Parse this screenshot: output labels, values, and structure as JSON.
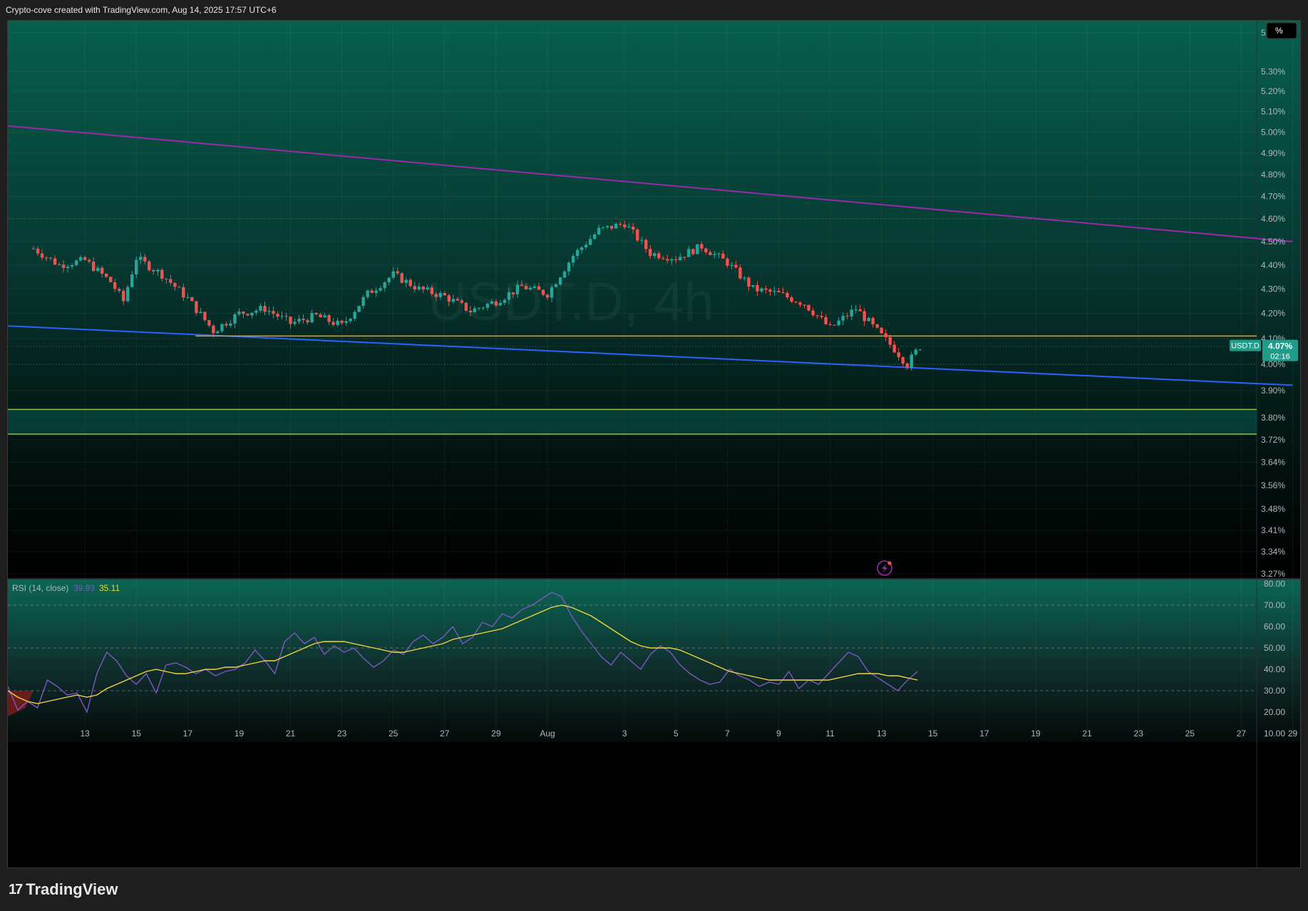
{
  "header": {
    "caption": "Crypto-cove created with TradingView.com, Aug 14, 2025 17:57 UTC+6"
  },
  "brand": {
    "mark": "17",
    "name": "TradingView"
  },
  "main_pane": {
    "watermark": "USDT.D, 4h",
    "scale_button": "%",
    "price_tag": {
      "symbol": "USDT.D",
      "value": "4.07%",
      "countdown": "02:16"
    },
    "y_ticks": [
      "5.50%",
      "5.30%",
      "5.20%",
      "5.10%",
      "5.00%",
      "4.90%",
      "4.80%",
      "4.70%",
      "4.60%",
      "4.50%",
      "4.40%",
      "4.30%",
      "4.20%",
      "4.10%",
      "4.00%",
      "3.90%",
      "3.80%",
      "3.72%",
      "3.64%",
      "3.56%",
      "3.48%",
      "3.41%",
      "3.34%",
      "3.27%"
    ]
  },
  "rsi_pane": {
    "label": "RSI (14, close)",
    "rsi_value": "39.93",
    "ma_value": "35.11",
    "y_ticks": [
      "80.00",
      "70.00",
      "60.00",
      "50.00",
      "40.00",
      "30.00",
      "20.00",
      "10.00"
    ]
  },
  "time_axis": {
    "labels": [
      "13",
      "15",
      "17",
      "19",
      "21",
      "23",
      "25",
      "27",
      "29",
      "Aug",
      "3",
      "5",
      "7",
      "9",
      "11",
      "13",
      "15",
      "17",
      "19",
      "21",
      "23",
      "25",
      "27",
      "29"
    ]
  },
  "colors": {
    "bull": "#26a69a",
    "bear": "#ef5350",
    "upper_trendline": "#9c27b0",
    "lower_trendline": "#2962ff",
    "horizontal_level": "#ff9800",
    "support_zone": "#8bc34a",
    "rsi_line": "#7e57c2",
    "rsi_ma": "#f5d33a"
  },
  "chart_data": [
    {
      "type": "candlestick",
      "symbol": "USDT.D",
      "timeframe": "4h",
      "y_unit": "%",
      "ylim": [
        3.27,
        5.55
      ],
      "y_scale": "log",
      "x_range": [
        "Jul 11",
        "Aug 30"
      ],
      "approx_closes": [
        {
          "date": "Jul 11",
          "close": 4.47
        },
        {
          "date": "Jul 12",
          "close": 4.4
        },
        {
          "date": "Jul 13",
          "close": 4.42
        },
        {
          "date": "Jul 14",
          "close": 4.33
        },
        {
          "date": "Jul 14.5",
          "close": 4.25
        },
        {
          "date": "Jul 15",
          "close": 4.43
        },
        {
          "date": "Jul 16",
          "close": 4.36
        },
        {
          "date": "Jul 17",
          "close": 4.26
        },
        {
          "date": "Jul 18",
          "close": 4.13
        },
        {
          "date": "Jul 19",
          "close": 4.2
        },
        {
          "date": "Jul 20",
          "close": 4.22
        },
        {
          "date": "Jul 21",
          "close": 4.16
        },
        {
          "date": "Jul 22",
          "close": 4.19
        },
        {
          "date": "Jul 23",
          "close": 4.15
        },
        {
          "date": "Jul 24",
          "close": 4.28
        },
        {
          "date": "Jul 25",
          "close": 4.36
        },
        {
          "date": "Jul 26",
          "close": 4.3
        },
        {
          "date": "Jul 27",
          "close": 4.27
        },
        {
          "date": "Jul 28",
          "close": 4.21
        },
        {
          "date": "Jul 29",
          "close": 4.25
        },
        {
          "date": "Jul 30",
          "close": 4.31
        },
        {
          "date": "Jul 31",
          "close": 4.28
        },
        {
          "date": "Aug 1",
          "close": 4.44
        },
        {
          "date": "Aug 2",
          "close": 4.55
        },
        {
          "date": "Aug 3",
          "close": 4.58
        },
        {
          "date": "Aug 4",
          "close": 4.45
        },
        {
          "date": "Aug 5",
          "close": 4.43
        },
        {
          "date": "Aug 6",
          "close": 4.48
        },
        {
          "date": "Aug 7",
          "close": 4.41
        },
        {
          "date": "Aug 8",
          "close": 4.3
        },
        {
          "date": "Aug 9",
          "close": 4.28
        },
        {
          "date": "Aug 10",
          "close": 4.24
        },
        {
          "date": "Aug 11",
          "close": 4.14
        },
        {
          "date": "Aug 12",
          "close": 4.22
        },
        {
          "date": "Aug 13",
          "close": 4.11
        },
        {
          "date": "Aug 13.5",
          "close": 4.06
        },
        {
          "date": "Aug 14",
          "close": 4.0
        },
        {
          "date": "Aug 14.5",
          "close": 4.07
        }
      ],
      "current_value": 4.07,
      "annotations": [
        {
          "kind": "trendline",
          "name": "upper",
          "color": "purple",
          "from": {
            "date": "Jul 10",
            "value": 5.03
          },
          "to": {
            "date": "Aug 29",
            "value": 4.5
          }
        },
        {
          "kind": "trendline",
          "name": "lower",
          "color": "blue",
          "from": {
            "date": "Jul 10",
            "value": 4.15
          },
          "to": {
            "date": "Aug 29",
            "value": 3.92
          }
        },
        {
          "kind": "horizontal",
          "color": "orange",
          "value": 4.11
        },
        {
          "kind": "zone",
          "color": "green",
          "from": 3.74,
          "to": 3.83
        }
      ]
    },
    {
      "type": "line",
      "name": "RSI (14, close)",
      "ylim": [
        10,
        80
      ],
      "bands": [
        30,
        50,
        70
      ],
      "series": [
        {
          "name": "RSI",
          "values": [
            32,
            21,
            25,
            22,
            35,
            32,
            28,
            29,
            20,
            38,
            48,
            44,
            37,
            33,
            38,
            29,
            42,
            43,
            41,
            38,
            40,
            37,
            39,
            40,
            43,
            49,
            44,
            38,
            53,
            57,
            52,
            55,
            47,
            51,
            48,
            50,
            45,
            41,
            44,
            49,
            47,
            53,
            56,
            52,
            55,
            60,
            52,
            55,
            62,
            60,
            66,
            64,
            68,
            70,
            73,
            76,
            74,
            65,
            58,
            52,
            46,
            42,
            48,
            44,
            40,
            47,
            51,
            48,
            42,
            38,
            35,
            33,
            34,
            40,
            37,
            35,
            32,
            34,
            33,
            39,
            31,
            35,
            33,
            38,
            43,
            48,
            46,
            39,
            36,
            33,
            30,
            35,
            39
          ],
          "last": 39.93
        },
        {
          "name": "RSI MA",
          "values": [
            30,
            27,
            25,
            24,
            25,
            26,
            27,
            28,
            27,
            28,
            31,
            33,
            35,
            37,
            39,
            40,
            39,
            38,
            38,
            39,
            40,
            40,
            41,
            41,
            42,
            43,
            44,
            44,
            46,
            48,
            50,
            52,
            53,
            53,
            53,
            52,
            51,
            50,
            49,
            48,
            48,
            49,
            50,
            51,
            52,
            54,
            55,
            56,
            57,
            58,
            59,
            61,
            63,
            65,
            67,
            69,
            70,
            69,
            67,
            65,
            62,
            59,
            56,
            53,
            51,
            50,
            50,
            50,
            49,
            47,
            45,
            43,
            41,
            39,
            38,
            37,
            36,
            35,
            35,
            35,
            35,
            35,
            35,
            35,
            36,
            37,
            38,
            38,
            38,
            37,
            37,
            36,
            35
          ],
          "last": 35.11
        }
      ]
    }
  ]
}
